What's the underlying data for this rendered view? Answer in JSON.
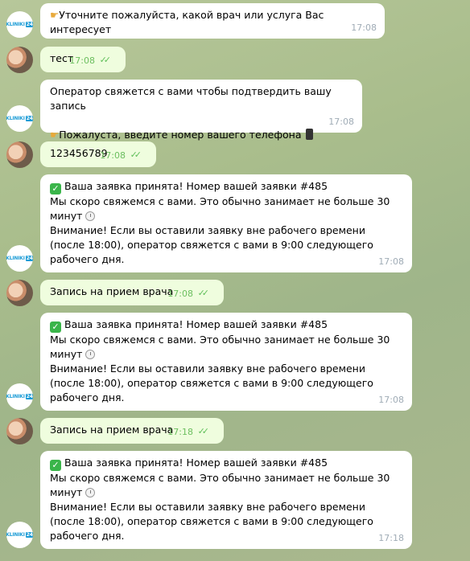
{
  "messages": [
    {
      "sender": "bot",
      "lines": [
        "👉Уточните пожалуйста, какой врач или услуга Вас интересует"
      ],
      "time": "17:08"
    },
    {
      "sender": "user",
      "text": "тест",
      "time": "17:08"
    },
    {
      "sender": "bot",
      "lines": [
        "Оператор свяжется с вами чтобы подтвердить вашу запись",
        "",
        "👉Пожалуста, введите номер вашего телефона 📱"
      ],
      "time": "17:08"
    },
    {
      "sender": "user",
      "text": "123456789",
      "time": "17:08"
    },
    {
      "sender": "bot",
      "lines": [
        "✅ Ваша заявка принята! Номер вашей заявки #485",
        "Мы скоро свяжемся с вами. Это обычно занимает не больше 30",
        "минут 🕕",
        "Внимание! Если вы оставили заявку вне рабочего времени",
        "(после 18:00), оператор свяжется с вами в 9:00 следующего",
        "рабочего дня."
      ],
      "time": "17:08"
    },
    {
      "sender": "user",
      "text": "Запись на прием врача",
      "time": "17:08"
    },
    {
      "sender": "bot",
      "lines": [
        "✅ Ваша заявка принята! Номер вашей заявки #485",
        "Мы скоро свяжемся с вами. Это обычно занимает не больше 30",
        "минут 🕕",
        "Внимание! Если вы оставили заявку вне рабочего времени",
        "(после 18:00), оператор свяжется с вами в 9:00 следующего",
        "рабочего дня."
      ],
      "time": "17:08"
    },
    {
      "sender": "user",
      "text": "Запись на прием врача",
      "time": "17:18"
    },
    {
      "sender": "bot",
      "lines": [
        "✅ Ваша заявка принята! Номер вашей заявки #485",
        "Мы скоро свяжемся с вами. Это обычно занимает не больше 30",
        "минут 🕕",
        "Внимание! Если вы оставили заявку вне рабочего времени",
        "(после 18:00), оператор свяжется с вами в 9:00 следующего",
        "рабочего дня."
      ],
      "time": "17:18"
    }
  ],
  "bot_logo": {
    "text": "KLINIKI",
    "box": "24"
  },
  "colors": {
    "incoming_bubble": "#ffffff",
    "outgoing_bubble": "#effdde",
    "read_ticks": "#5fbf5a"
  },
  "icons": {
    "read_status": "double-check-icon",
    "hand": "pointing-hand-icon",
    "check": "check-mark-icon",
    "clock": "clock-icon",
    "phone": "mobile-phone-icon"
  }
}
